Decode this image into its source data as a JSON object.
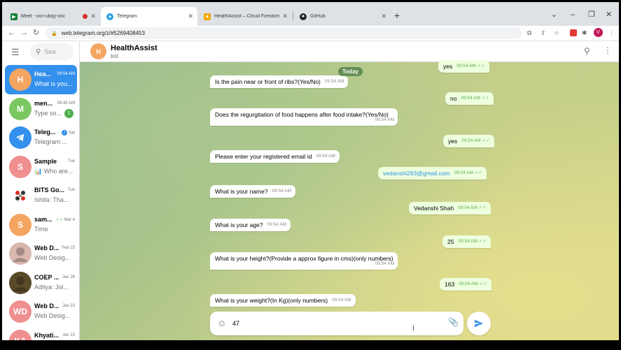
{
  "browser": {
    "tabs": [
      {
        "title": "Meet - vxn-ubqy-oxc",
        "color": "#188038"
      },
      {
        "title": "Telegram",
        "color": "#2aa3e0"
      },
      {
        "title": "HealthAssist – Cloud Firestore – F",
        "color": "#f6a700"
      },
      {
        "title": "GitHub",
        "color": "#24292f"
      }
    ],
    "url": "web.telegram.org/z/#5269408453",
    "profile_initial": "V"
  },
  "sidebar": {
    "search_placeholder": "Sea",
    "chats": [
      {
        "avatar": "H",
        "color": "#f5a562",
        "name": "Hea...",
        "time": "09:54 AM",
        "preview": "What is you...",
        "active": true
      },
      {
        "avatar": "M",
        "color": "#7bc862",
        "name": "men...",
        "time": "09:45 AM",
        "preview": "Type so...",
        "badge": "1"
      },
      {
        "avatar": "",
        "color": "#3390ec",
        "name": "Teleg...",
        "time": "Sat",
        "preview": "Telegram ...",
        "verified": true,
        "logo": true
      },
      {
        "avatar": "S",
        "color": "#ef8f8f",
        "name": "Sample",
        "time": "Tue",
        "preview": "📊 Who are..."
      },
      {
        "avatar": "",
        "color": "#ffffff",
        "name": "BITS Go...",
        "time": "Tue",
        "preview": "Ishita: Tha...",
        "img": "pattern"
      },
      {
        "avatar": "S",
        "color": "#f5a562",
        "name": "sam...",
        "time": "Mar 4",
        "preview": "Time",
        "read": "✓✓"
      },
      {
        "avatar": "",
        "color": "#d9b8b0",
        "name": "Web D...",
        "time": "Feb 23",
        "preview": "Web Desig...",
        "img": "photo"
      },
      {
        "avatar": "",
        "color": "#5a4a2a",
        "name": "COEP ...",
        "time": "Jan 26",
        "preview": "Aditya: Joi...",
        "img": "photo"
      },
      {
        "avatar": "WD",
        "color": "#ef8f8f",
        "name": "Web D...",
        "time": "Jan 23",
        "preview": "Web Desig..."
      },
      {
        "avatar": "KA",
        "color": "#ef8f8f",
        "name": "Khyati...",
        "time": "Jan 23",
        "preview": ""
      }
    ]
  },
  "chat": {
    "title": "HealthAssist",
    "subtitle": "bot",
    "avatar": "H",
    "date_divider": "Today",
    "messages": [
      {
        "dir": "out",
        "text": "yes",
        "time": "09:54 AM"
      },
      {
        "dir": "in",
        "text": "Is the pain near or front of ribs?(Yes/No)",
        "time": "09:54 AM"
      },
      {
        "dir": "out",
        "text": "no",
        "time": "09:54 AM"
      },
      {
        "dir": "in",
        "text": "Does the regurgitation of food happens after food intake?(Yes/No)",
        "time": "09:54 AM"
      },
      {
        "dir": "out",
        "text": "yes",
        "time": "09:54 AM"
      },
      {
        "dir": "in",
        "text": "Please enter your registered email id",
        "time": "09:54 AM"
      },
      {
        "dir": "out",
        "text": "vedanshi283@gmail.com",
        "time": "09:54 AM"
      },
      {
        "dir": "in",
        "text": "What is your name?",
        "time": "09:54 AM"
      },
      {
        "dir": "out",
        "text": "Vedanshi Shah",
        "time": "09:54 AM"
      },
      {
        "dir": "in",
        "text": "What is your age?",
        "time": "09:54 AM"
      },
      {
        "dir": "out",
        "text": "25",
        "time": "09:54 AM"
      },
      {
        "dir": "in",
        "text": "What is your height?(Provide a approx figure in cms)(only numbers)",
        "time": "09:54 AM"
      },
      {
        "dir": "out",
        "text": "163",
        "time": "09:54 AM"
      },
      {
        "dir": "in",
        "text": "What is your weight?(In Kg)(only numbers)",
        "time": "09:54 AM"
      }
    ],
    "composer_value": "47",
    "read_mark": "✓✓"
  }
}
